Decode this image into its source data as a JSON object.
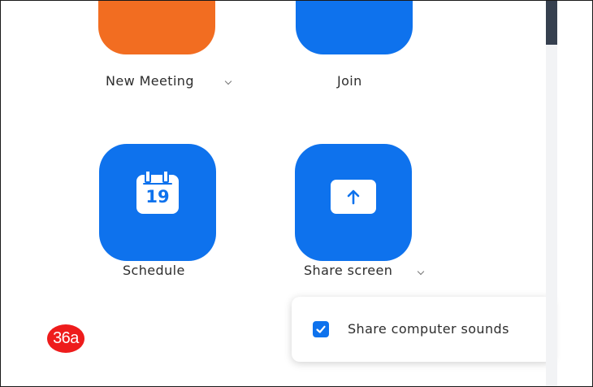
{
  "actions": {
    "new_meeting": {
      "label": "New Meeting",
      "icon": "video-camera-icon"
    },
    "join": {
      "label": "Join",
      "icon": "plus-icon"
    },
    "schedule": {
      "label": "Schedule",
      "icon": "calendar-icon",
      "calendar_day": "19"
    },
    "share_screen": {
      "label": "Share screen",
      "icon": "upload-arrow-icon"
    }
  },
  "share_options": {
    "share_computer_sounds": {
      "label": "Share computer sounds",
      "checked": true
    }
  },
  "annotation": {
    "label": "36a"
  },
  "colors": {
    "orange": "#f26d21",
    "blue": "#0e72ed",
    "badge_red": "#ee1c1c",
    "scrollbar": "#36404f"
  }
}
